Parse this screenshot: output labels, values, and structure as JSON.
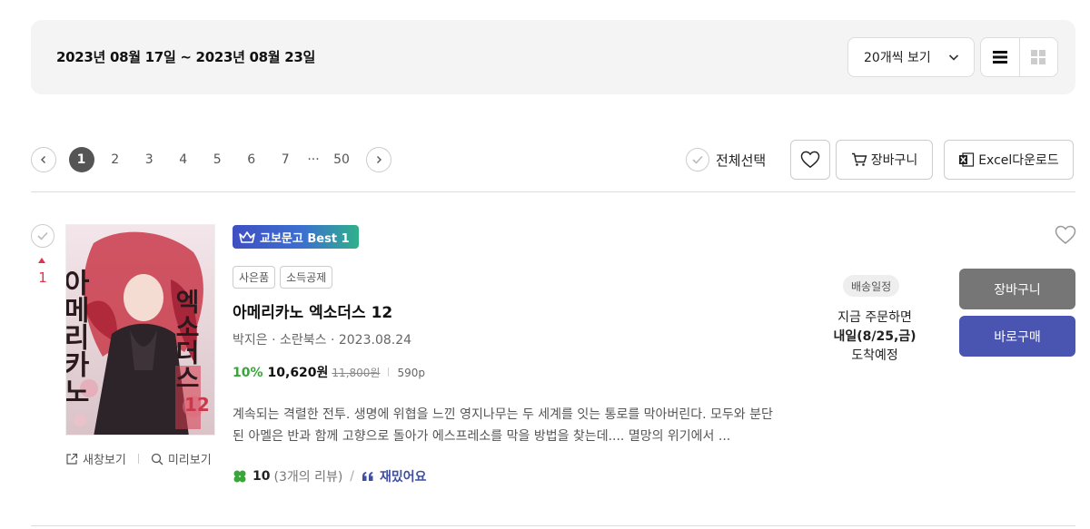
{
  "filter": {
    "date_range": "2023년 08월 17일 ~ 2023년 08월 23일",
    "per_page": "20개씩 보기"
  },
  "pagination": {
    "pages": [
      "1",
      "2",
      "3",
      "4",
      "5",
      "6",
      "7"
    ],
    "current": "1",
    "ellipsis": "···",
    "last_page": "50"
  },
  "toolbar": {
    "select_all": "전체선택",
    "cart": "장바구니",
    "excel": "Excel다운로드"
  },
  "product": {
    "rank": "1",
    "badge": "교보문고 Best 1",
    "tags": [
      "사은품",
      "소득공제"
    ],
    "title": "아메리카노 엑소더스 12",
    "meta": "박지은 · 소란북스 · 2023.08.24",
    "discount": "10%",
    "price": "10,620원",
    "original_price": "11,800원",
    "pages": "590p",
    "description": "계속되는 격렬한 전투. 생명에 위협을 느낀 영지나무는 두 세계를 잇는 통로를 막아버린다. 모두와 분단된 아멜은 반과 함께 고향으로 돌아가 에스프레소를 막을 방법을 찾는데.... 멸망의 위기에서 ...",
    "review_score": "10",
    "review_count": "(3개의 리뷰)",
    "review_slash": "/",
    "review_keyword": "재밌어요",
    "new_window": "새창보기",
    "preview": "미리보기",
    "cover_title_left": "아메리카노",
    "cover_title_right": "엑소더스",
    "cover_number": "12",
    "shipping": {
      "label": "배송일정",
      "line1": "지금 주문하면",
      "line2": "내일(8/25,금)",
      "line3": "도착예정"
    },
    "cart_button": "장바구니",
    "buy_button": "바로구매"
  }
}
